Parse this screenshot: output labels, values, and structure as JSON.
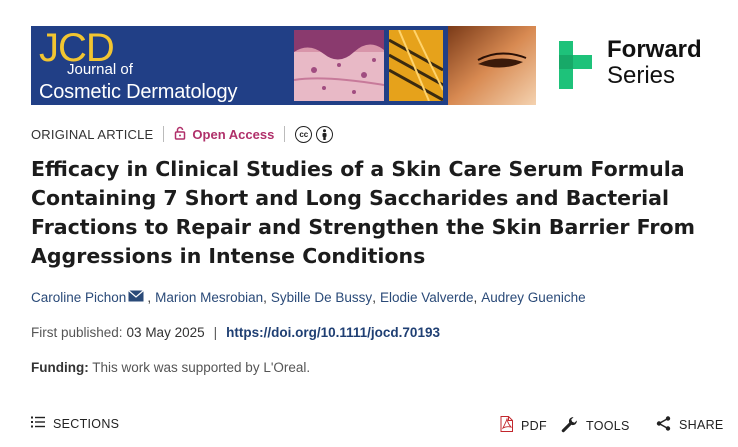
{
  "banner": {
    "logo": "JCD",
    "journal_line1": "Journal of",
    "journal_line2": "Cosmetic Dermatology"
  },
  "forward_series": {
    "line1": "Forward",
    "line2": "Series",
    "logo_color": "#1ec27a"
  },
  "meta": {
    "article_type": "ORIGINAL ARTICLE",
    "access_label": "Open Access",
    "access_color": "#b0306a",
    "license_icons": [
      "cc-icon",
      "by-attribution-icon"
    ]
  },
  "title": "Efficacy in Clinical Studies of a Skin Care Serum Formula Containing 7 Short and Long Saccharides and Bacterial Fractions to Repair and Strengthen the Skin Barrier From Aggressions in Intense Conditions",
  "authors": [
    "Caroline Pichon",
    "Marion Mesrobian",
    "Sybille De Bussy",
    "Elodie Valverde",
    "Audrey Gueniche"
  ],
  "published": {
    "label": "First published:",
    "date": "03 May 2025",
    "separator": "|",
    "doi": "https://doi.org/10.1111/jocd.70193"
  },
  "funding": {
    "label": "Funding:",
    "text": "This work was supported by L'Oreal."
  },
  "toolbar": {
    "sections": "SECTIONS",
    "pdf": "PDF",
    "tools": "TOOLS",
    "share": "SHARE"
  }
}
